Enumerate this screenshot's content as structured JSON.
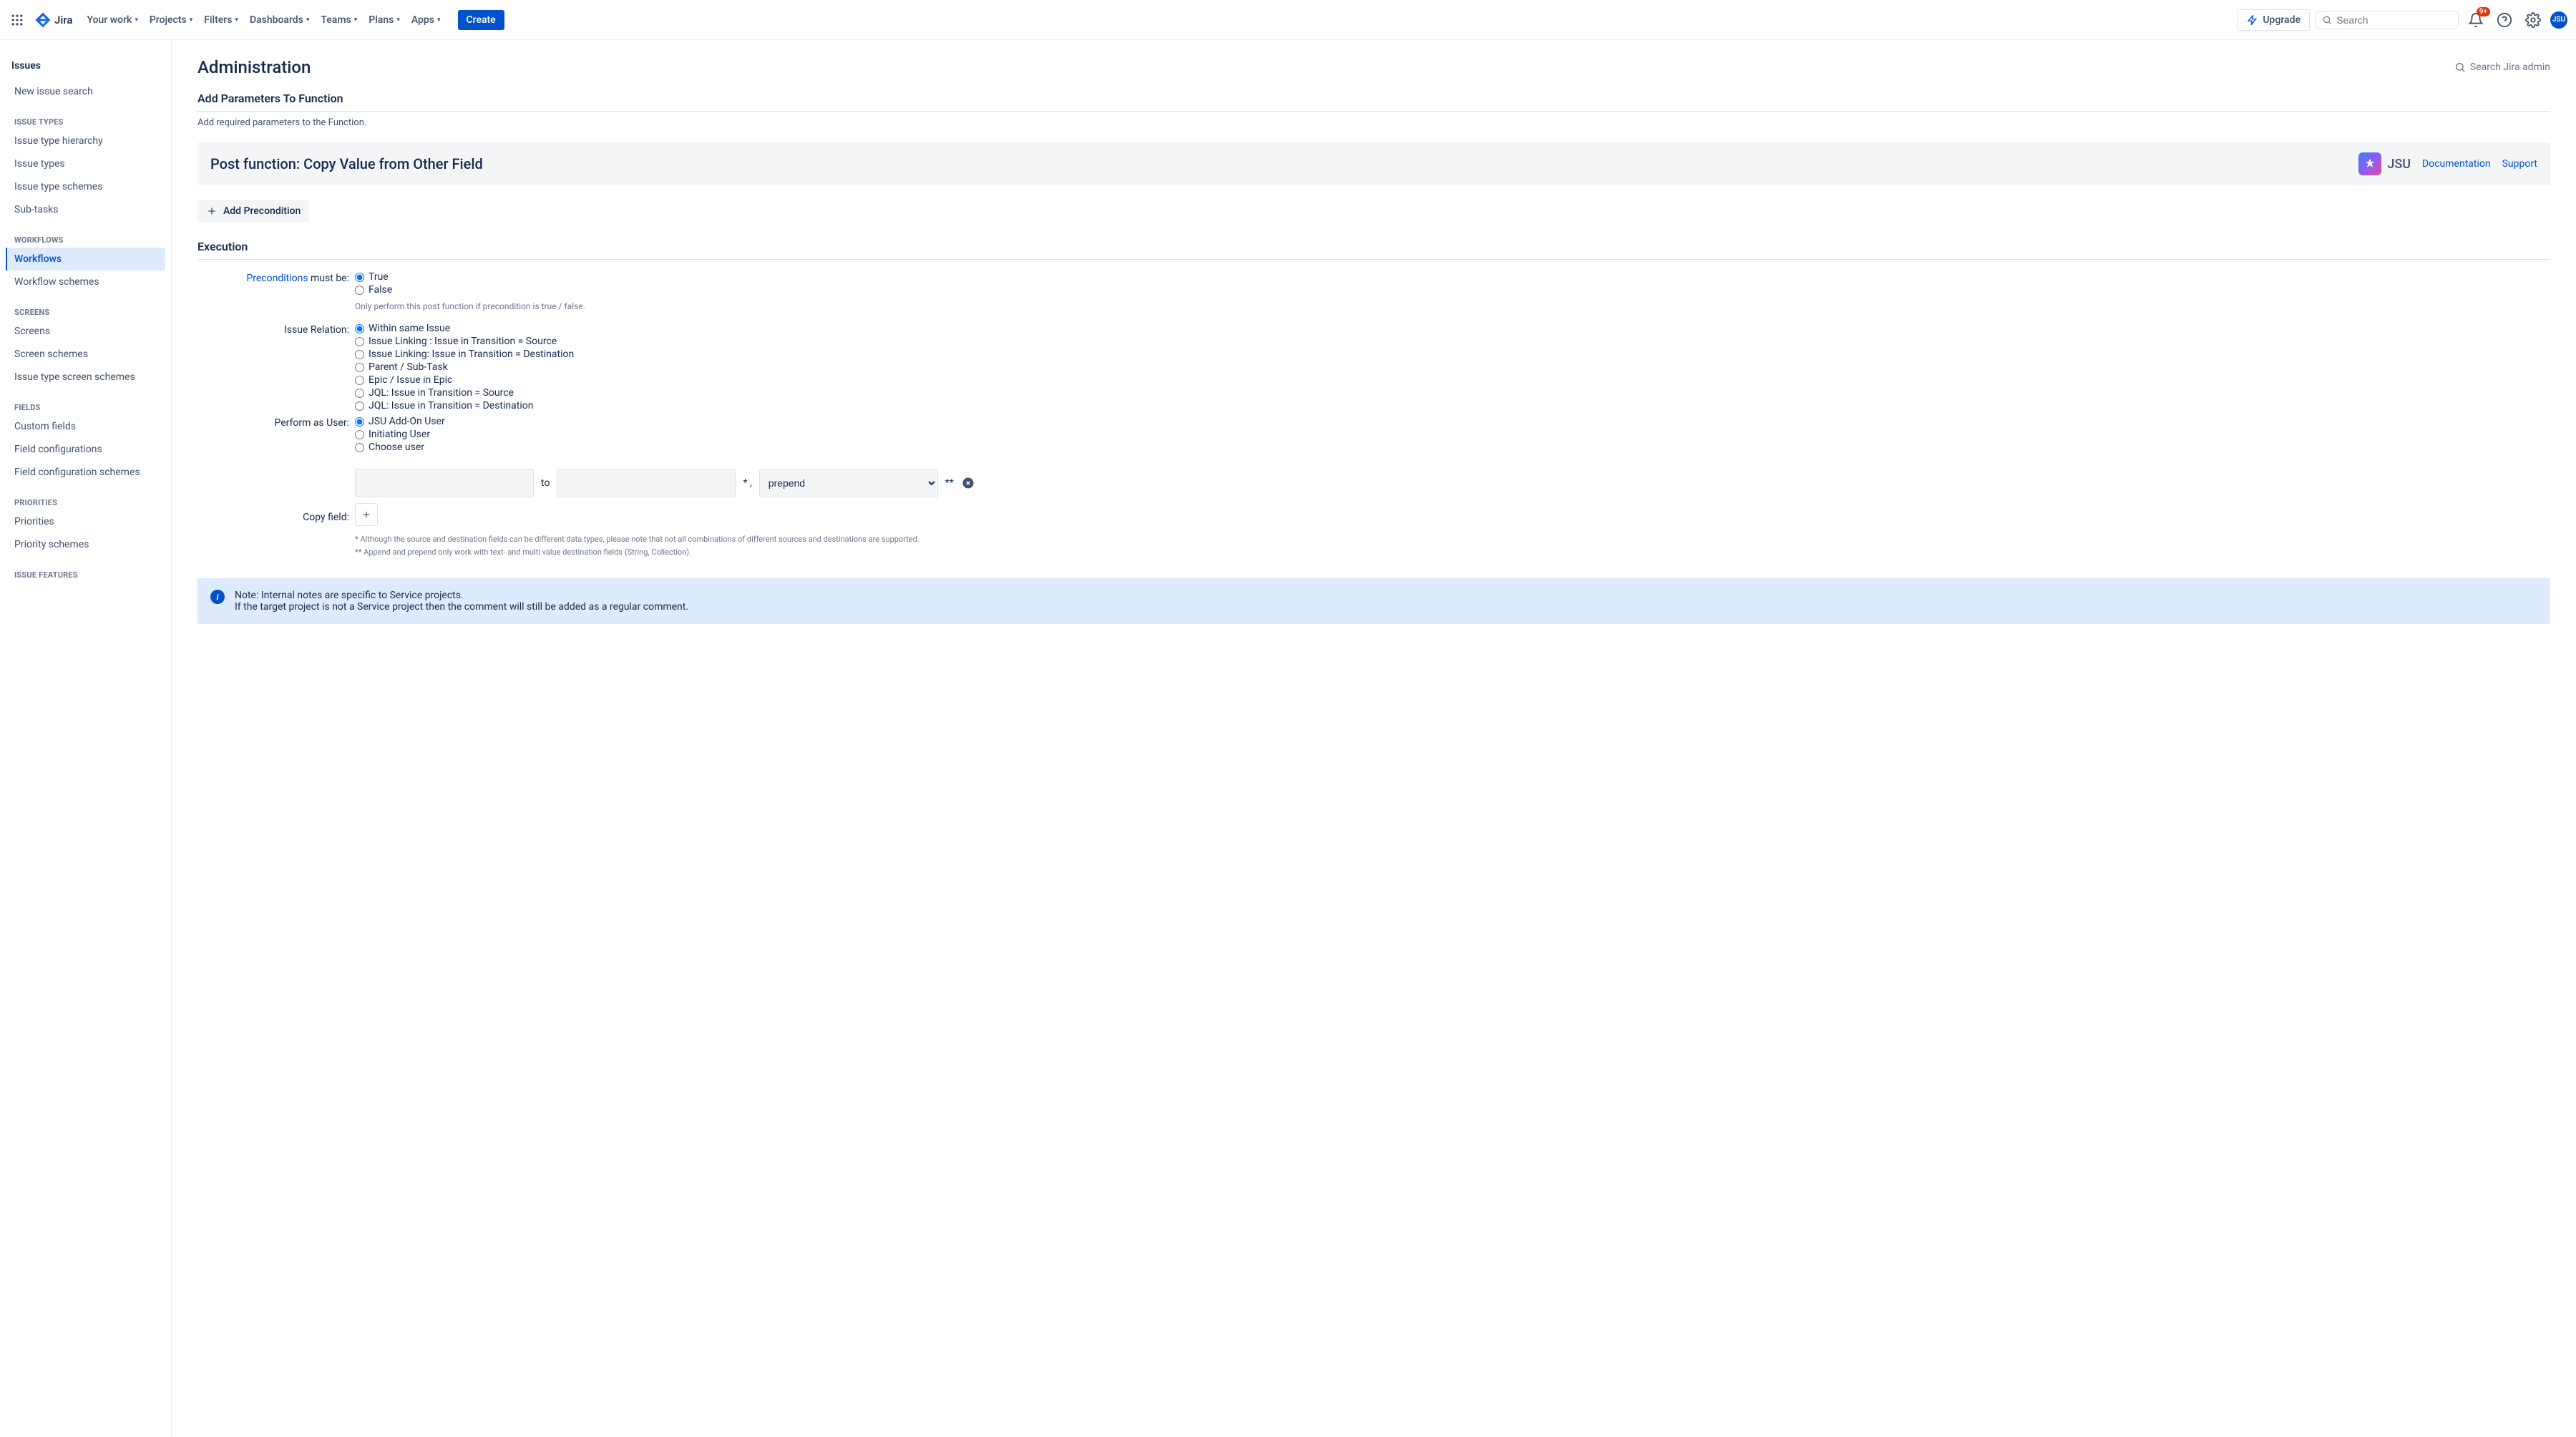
{
  "nav": {
    "product": "Jira",
    "items": [
      "Your work",
      "Projects",
      "Filters",
      "Dashboards",
      "Teams",
      "Plans",
      "Apps"
    ],
    "create": "Create",
    "upgrade": "Upgrade",
    "search_placeholder": "Search",
    "notif_count": "9+",
    "avatar_initials": "JSU"
  },
  "sidebar": {
    "title": "Issues",
    "top_items": [
      "New issue search"
    ],
    "groups": [
      {
        "label": "ISSUE TYPES",
        "items": [
          "Issue type hierarchy",
          "Issue types",
          "Issue type schemes",
          "Sub-tasks"
        ]
      },
      {
        "label": "WORKFLOWS",
        "items": [
          "Workflows",
          "Workflow schemes"
        ],
        "active_index": 0
      },
      {
        "label": "SCREENS",
        "items": [
          "Screens",
          "Screen schemes",
          "Issue type screen schemes"
        ]
      },
      {
        "label": "FIELDS",
        "items": [
          "Custom fields",
          "Field configurations",
          "Field configuration schemes"
        ]
      },
      {
        "label": "PRIORITIES",
        "items": [
          "Priorities",
          "Priority schemes"
        ]
      },
      {
        "label": "ISSUE FEATURES",
        "items": []
      }
    ]
  },
  "main": {
    "page_title": "Administration",
    "search_admin": "Search Jira admin",
    "section_title": "Add Parameters To Function",
    "section_desc": "Add required parameters to the Function.",
    "function_title": "Post function: Copy Value from Other Field",
    "jsu_label": "JSU",
    "doc_link": "Documentation",
    "support_link": "Support",
    "add_precondition": "Add Precondition",
    "execution_title": "Execution",
    "form": {
      "preconditions_label": "Preconditions",
      "preconditions_suffix": " must be:",
      "precond_options": [
        "True",
        "False"
      ],
      "precond_selected": 0,
      "precond_help": "Only perform this post function if precondition is true / false.",
      "issue_relation_label": "Issue Relation:",
      "issue_relation_options": [
        "Within same Issue",
        "Issue Linking : Issue in Transition = Source",
        "Issue Linking: Issue in Transition = Destination",
        "Parent / Sub-Task",
        "Epic / Issue in Epic",
        "JQL: Issue in Transition = Source",
        "JQL: Issue in Transition = Destination"
      ],
      "issue_relation_selected": 0,
      "perform_user_label": "Perform as User:",
      "perform_user_options": [
        "JSU Add-On User",
        "Initiating User",
        "Choose user"
      ],
      "perform_user_selected": 0,
      "copy_field_label": "Copy field:",
      "copy_to": "to",
      "copy_sep1": "* ,",
      "copy_select_value": "prepend",
      "copy_sep2": "**",
      "footnote1": "* Although the source and destination fields can be different data types, please note that not all combinations of different sources and destinations are supported.",
      "footnote2": "** Append and prepend only work with text- and multi value destination fields (String, Collection)."
    },
    "info_note_line1": "Note: Internal notes are specific to Service projects.",
    "info_note_line2": "If the target project is not a Service project then the comment will still be added as a regular comment."
  }
}
